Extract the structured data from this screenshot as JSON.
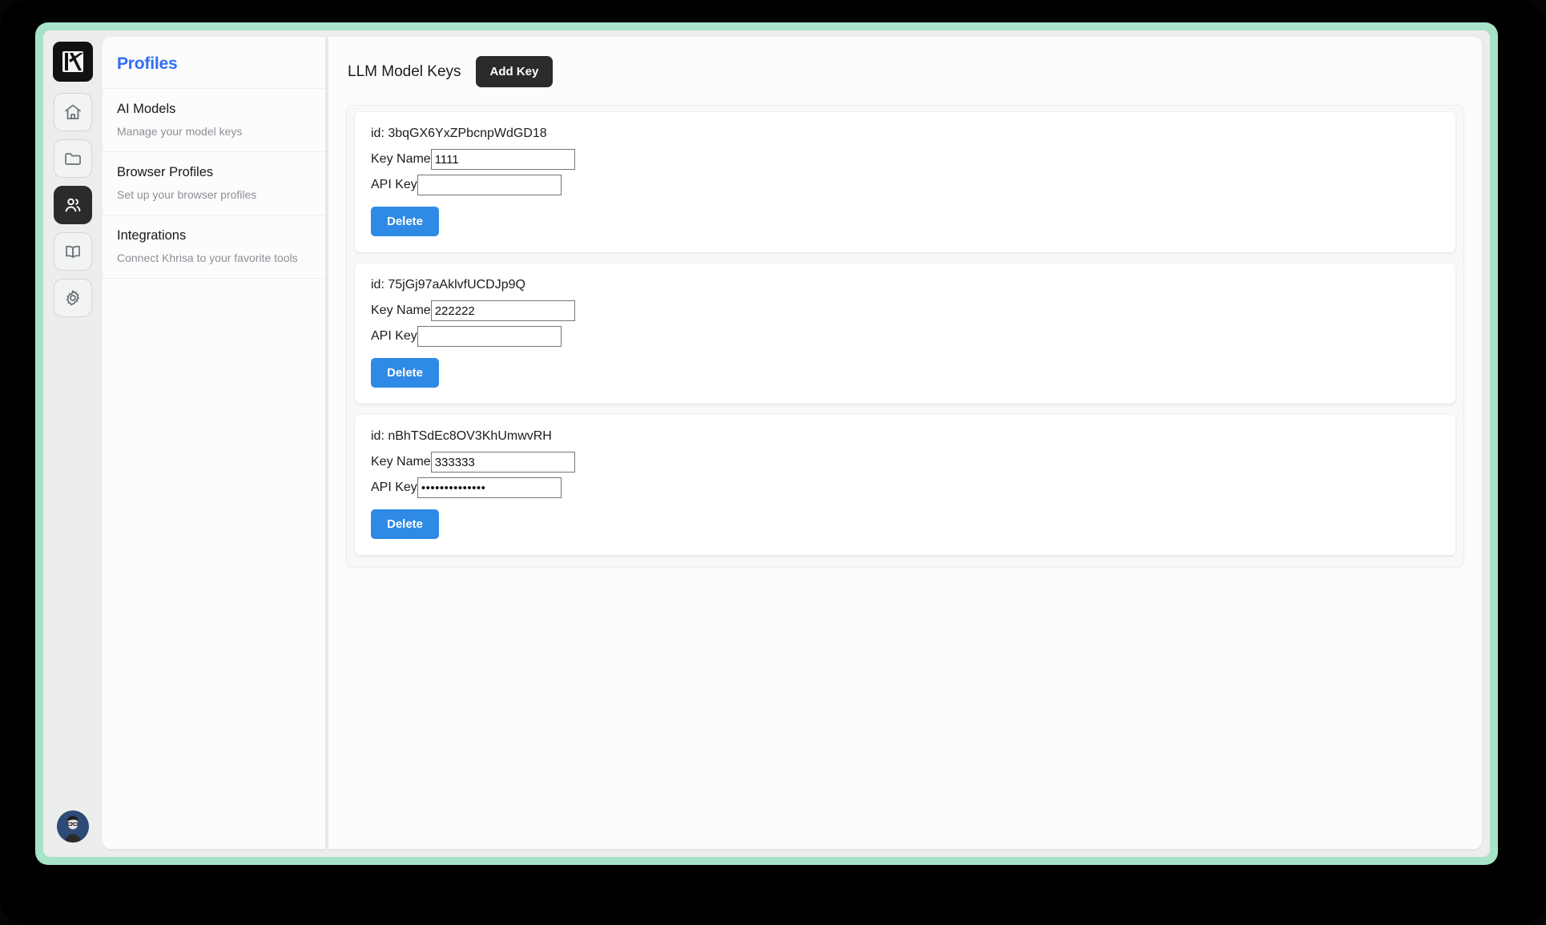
{
  "theme": {
    "frame_color": "#a6e3c8",
    "accent_blue": "#2f6dfb",
    "button_dark": "#2b2b2b",
    "delete_blue": "#2e8ae5",
    "app_bg": "#eceded"
  },
  "icon_rail": {
    "logo": {
      "name": "khrisa-logo",
      "letter": "K"
    },
    "buttons": [
      {
        "name": "home-icon",
        "label": "Home",
        "active": false
      },
      {
        "name": "folder-icon",
        "label": "Files",
        "active": false
      },
      {
        "name": "people-icon",
        "label": "Profiles",
        "active": true
      },
      {
        "name": "book-icon",
        "label": "Docs",
        "active": false
      },
      {
        "name": "gear-icon",
        "label": "Settings",
        "active": false
      }
    ],
    "avatar": {
      "name": "user-avatar",
      "label": "Account"
    }
  },
  "sidebar": {
    "title": "Profiles",
    "items": [
      {
        "title": "AI Models",
        "subtitle": "Manage your model keys"
      },
      {
        "title": "Browser Profiles",
        "subtitle": "Set up your browser profiles"
      },
      {
        "title": "Integrations",
        "subtitle": "Connect Khrisa to your favorite tools"
      }
    ]
  },
  "main": {
    "section_title": "LLM Model Keys",
    "add_key_label": "Add Key",
    "labels": {
      "key_name": "Key Name",
      "api_key": "API Key",
      "delete": "Delete",
      "id_prefix": "id: "
    },
    "keys": [
      {
        "id_text": "id: 3bqGX6YxZPbcnpWdGD18",
        "key_name": "1111",
        "api_key": "",
        "delete_label": "Delete"
      },
      {
        "id_text": "id: 75jGj97aAklvfUCDJp9Q",
        "key_name": "222222",
        "api_key": "",
        "delete_label": "Delete"
      },
      {
        "id_text": "id: nBhTSdEc8OV3KhUmwvRH",
        "key_name": "333333",
        "api_key": "••••••••••••••",
        "delete_label": "Delete"
      }
    ]
  }
}
